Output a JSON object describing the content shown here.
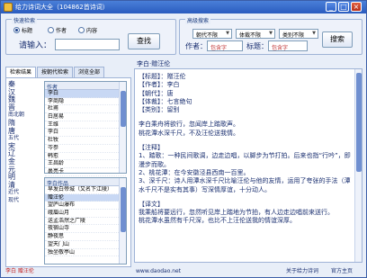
{
  "window": {
    "title": "给力诗词大全（104862首诗词）",
    "minimize_glyph": "_",
    "maximize_glyph": "□",
    "close_glyph": "×"
  },
  "search": {
    "legend": "快速检索",
    "radio_title": "标题",
    "radio_author": "作者",
    "radio_content": "内容",
    "selected": "title",
    "prompt": "请输入：",
    "button": "查找"
  },
  "advanced": {
    "legend": "高级搜索",
    "dynasty": "朝代不限",
    "genre": "体裁不限",
    "category": "类别不限",
    "author_label": "作者：",
    "author_placeholder": "包含字",
    "title_label": "标题：",
    "title_placeholder": "包含字",
    "button": "搜索"
  },
  "tabs": [
    "检索结果",
    "按朝代检索",
    "浏览全部"
  ],
  "dynasties": [
    "秦",
    "汉",
    "魏",
    "晋",
    "南北朝",
    "隋",
    "唐",
    "五代",
    "宋",
    "辽",
    "金",
    "元",
    "明",
    "清",
    "近代",
    "现代"
  ],
  "author_list": {
    "header": "作者",
    "items": [
      "李白",
      "李商隐",
      "杜甫",
      "白居易",
      "王维",
      "李白",
      "杜牧",
      "岑参",
      "韩愈",
      "王昌龄",
      "裹亮卡"
    ],
    "selected_index": 0
  },
  "title_list": {
    "header": "李白作品",
    "items": [
      "早发白帝城（又名下江陵）",
      "赠汪伦",
      "望庐山瀑布",
      "峨眉山月",
      "送孟浩然之广陵",
      "夜宿山寺",
      "静夜思",
      "望天门山",
      "独坐敬亭山"
    ],
    "selected_index": 1
  },
  "poem": {
    "header": "李白·赠汪伦",
    "meta": [
      "【标题】：赠汪伦",
      "【作者】：李白",
      "【朝代】：唐",
      "【体裁】：七言绝句",
      "【类别】：留别"
    ],
    "body": [
      "李白乘舟将欲行，忽闻岸上踏歌声。",
      "桃花潭水深千尺，不及汪伦送我情。"
    ],
    "notes_title": "【注释】",
    "notes": [
      "1、踏歌：一种民间歌调，边走边唱，以脚步为节打拍。后来也指“行吟”，即漫步而歌。",
      "2、桃花潭：在今安徽泾县西南一百里。",
      "3、深千尺：诗人用潭水深千尺比喻汪伦与他的友情，运用了夸张的手法（潭水千尺不是实有其事）写深情厚谊，十分动人。"
    ],
    "translation_title": "【译文】",
    "translation": [
      "我乘船将要远行，忽然听见岸上踏地为节拍，有人边走边唱前来送行。",
      "桃花潭水虽然有千尺深，也比不上汪伦送我的情谊深厚。"
    ]
  },
  "status": {
    "left": "李白 赠汪伦",
    "mid": "www.daodao.net",
    "right1": "关于给力诗词",
    "right2": "官方主页"
  }
}
